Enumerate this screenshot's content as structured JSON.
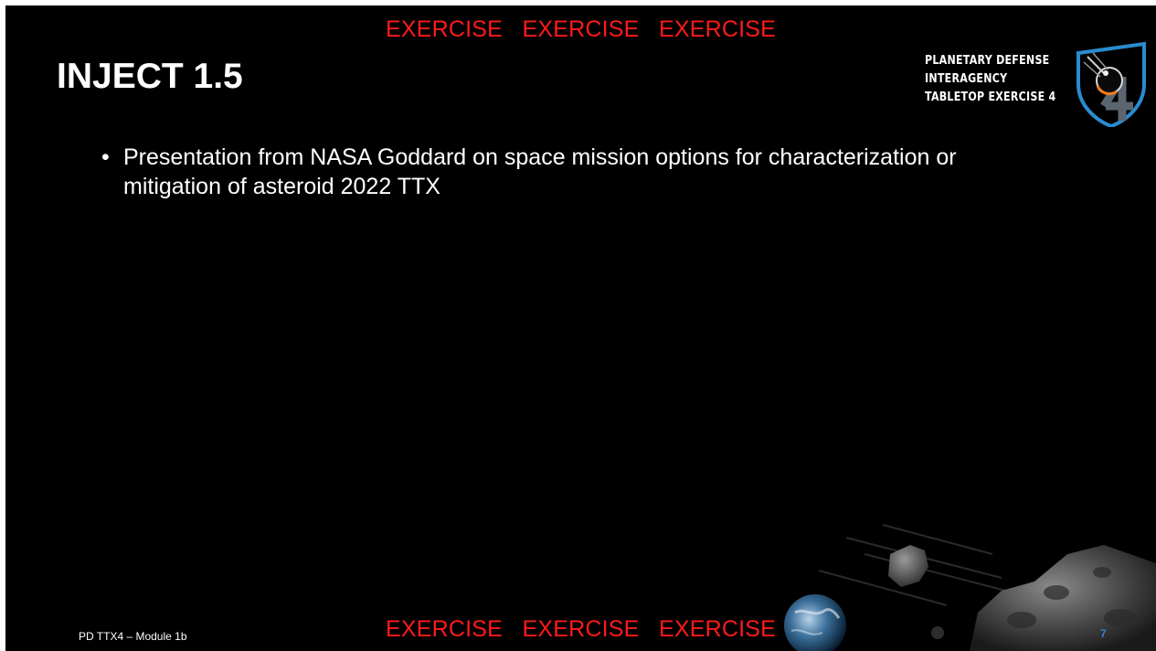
{
  "banner": {
    "top": "EXERCISE   EXERCISE   EXERCISE",
    "bottom": "EXERCISE   EXERCISE   EXERCISE"
  },
  "slide": {
    "title": "INJECT 1.5",
    "bullets": [
      "Presentation from NASA Goddard on space mission options for characterization or mitigation of asteroid 2022 TTX"
    ]
  },
  "logo": {
    "lines": [
      "PLANETARY DEFENSE",
      "INTERAGENCY",
      "TABLETOP EXERCISE 4"
    ],
    "emblem_icon": "planetary-defense-shield-emblem"
  },
  "footer": {
    "label": "PD TTX4 – Module 1b",
    "page_number": "7"
  },
  "colors": {
    "background": "#000000",
    "banner": "#ff1a1a",
    "text": "#ffffff",
    "page_number": "#3b7bd6"
  },
  "decoration": {
    "art_icon": "asteroid-and-earth-illustration"
  }
}
